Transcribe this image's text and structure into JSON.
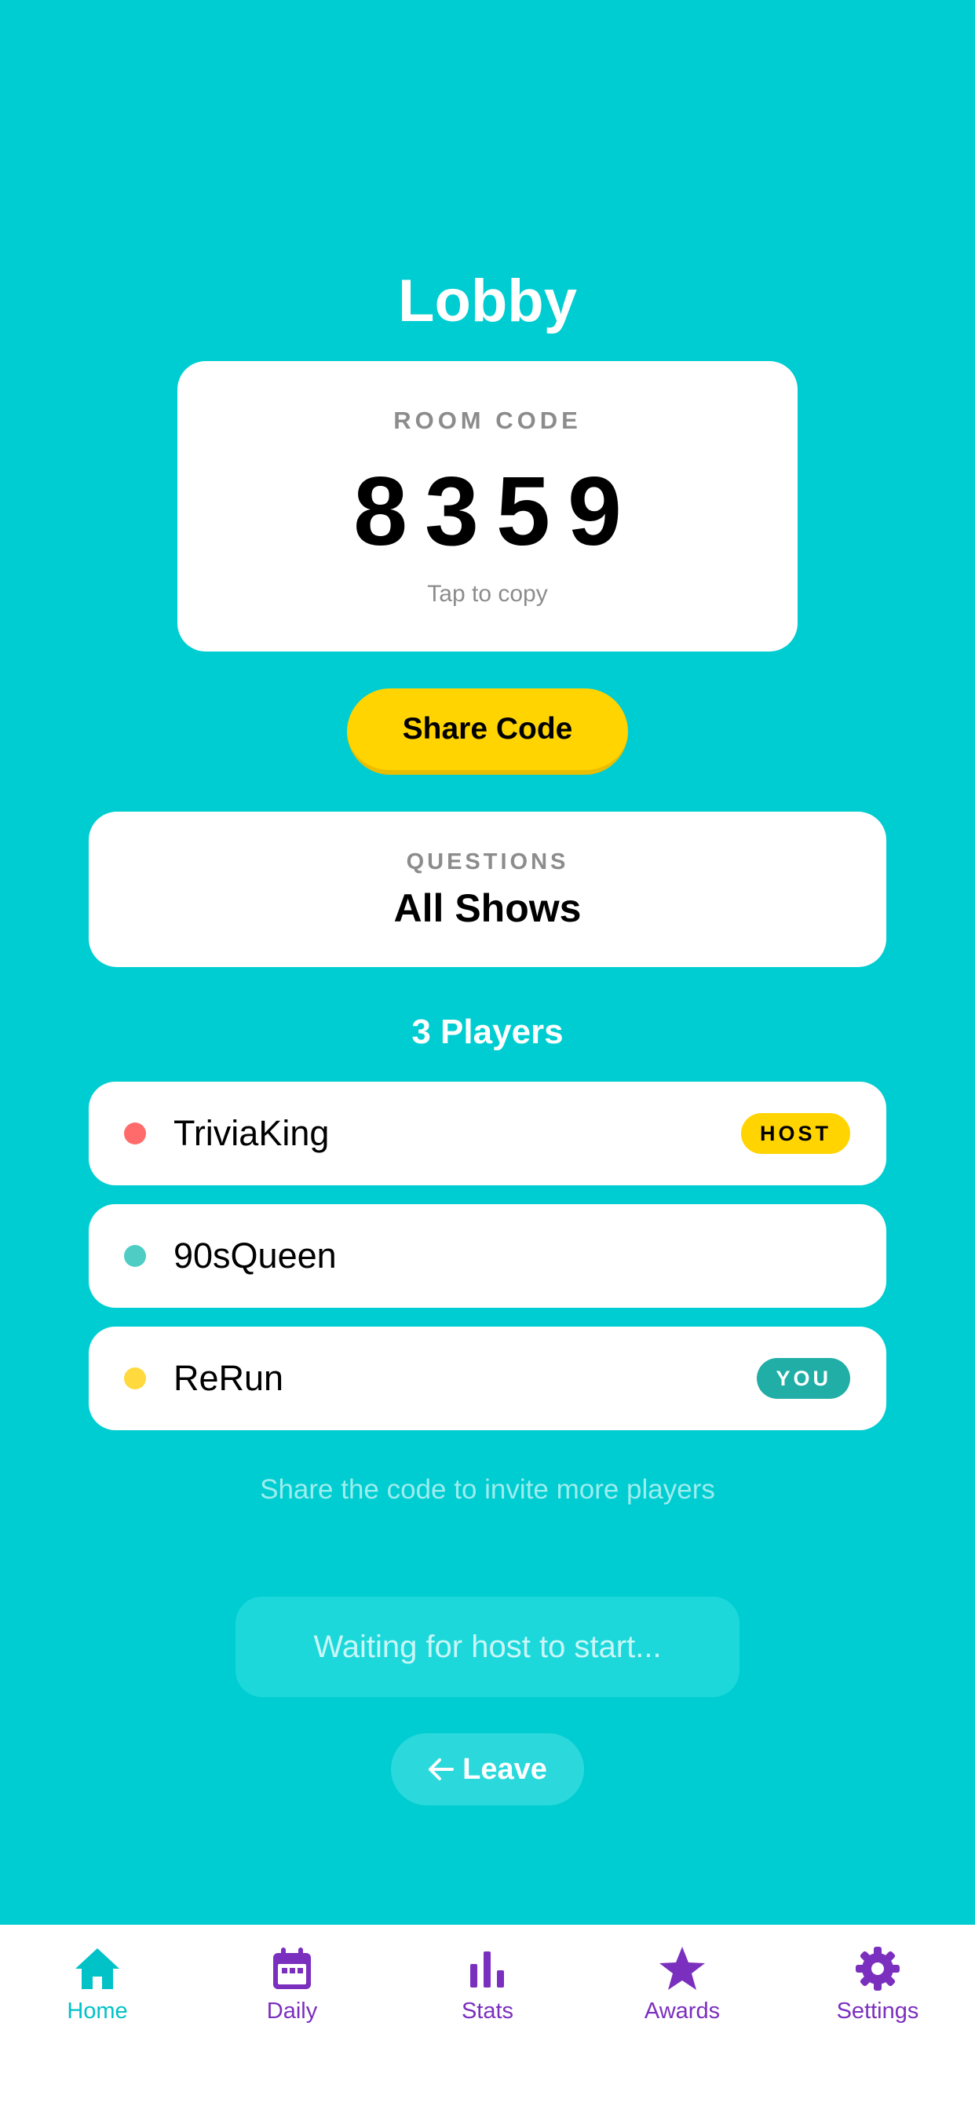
{
  "header": {
    "title": "Lobby"
  },
  "room": {
    "label": "ROOM CODE",
    "code": "8359",
    "hint": "Tap to copy"
  },
  "share_button": {
    "label": "Share Code"
  },
  "questions": {
    "label": "QUESTIONS",
    "value": "All Shows"
  },
  "players": {
    "heading": "3 Players",
    "list": [
      {
        "name": "TriviaKing",
        "dot_color": "#FF6B6B",
        "badge": "HOST"
      },
      {
        "name": "90sQueen",
        "dot_color": "#4ECDC4",
        "badge": ""
      },
      {
        "name": "ReRun",
        "dot_color": "#FFD93D",
        "badge": "YOU"
      }
    ]
  },
  "invite_hint": "Share the code to invite more players",
  "waiting_button": {
    "label": "Waiting for host to start..."
  },
  "leave_button": {
    "label": "Leave",
    "icon": "arrow-left-icon"
  },
  "tabbar": {
    "tabs": [
      {
        "label": "Home",
        "icon": "home-icon",
        "active": true
      },
      {
        "label": "Daily",
        "icon": "calendar-icon",
        "active": false
      },
      {
        "label": "Stats",
        "icon": "bar-chart-icon",
        "active": false
      },
      {
        "label": "Awards",
        "icon": "star-icon",
        "active": false
      },
      {
        "label": "Settings",
        "icon": "gear-icon",
        "active": false
      }
    ]
  },
  "colors": {
    "background": "#00CDD1",
    "accent_yellow": "#FFD400",
    "you_badge": "#20AEA6",
    "tab_active": "#00C2C7",
    "tab_inactive": "#7B2FBE"
  }
}
